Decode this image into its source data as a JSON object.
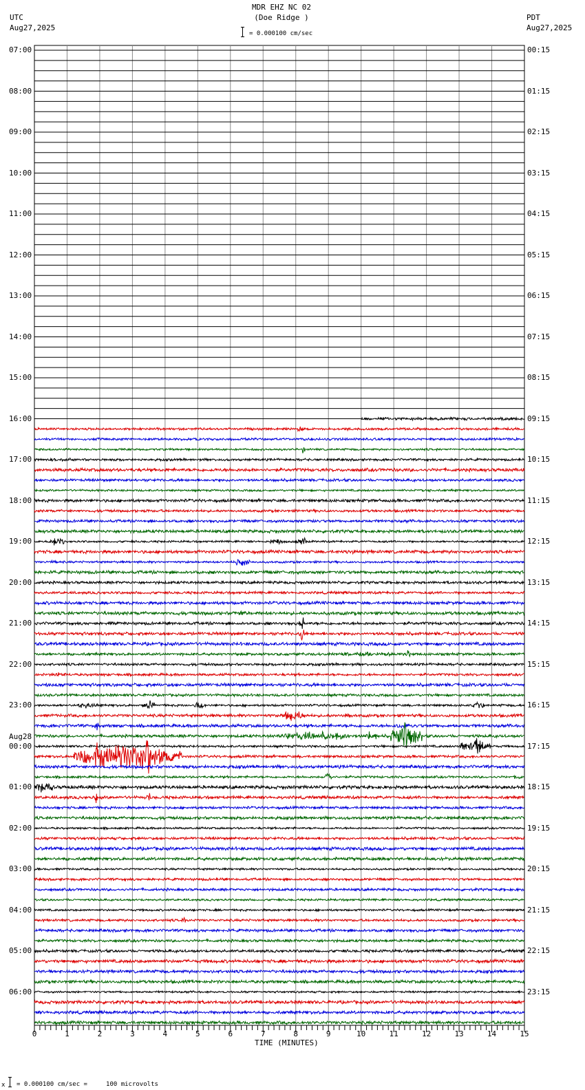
{
  "header": {
    "title": "MDR EHZ NC 02",
    "subtitle": "(Doe Ridge )",
    "left_tz": "UTC",
    "left_date": "Aug27,2025",
    "right_tz": "PDT",
    "right_date": "Aug27,2025",
    "scale_text": "= 0.000100 cm/sec"
  },
  "footer": {
    "prefix": "x",
    "scale_text": "= 0.000100 cm/sec =     100 microvolts"
  },
  "chart_data": {
    "type": "line",
    "title": "MDR EHZ NC 02 (Doe Ridge )",
    "xlabel": "TIME (MINUTES)",
    "xlim": [
      0,
      15
    ],
    "x_ticks": [
      "0",
      "1",
      "2",
      "3",
      "4",
      "5",
      "6",
      "7",
      "8",
      "9",
      "10",
      "11",
      "12",
      "13",
      "14",
      "15"
    ],
    "left_labels": [
      "07:00",
      "08:00",
      "09:00",
      "10:00",
      "11:00",
      "12:00",
      "13:00",
      "14:00",
      "15:00",
      "16:00",
      "17:00",
      "18:00",
      "19:00",
      "20:00",
      "21:00",
      "22:00",
      "23:00",
      "00:00",
      "01:00",
      "02:00",
      "03:00",
      "04:00",
      "05:00",
      "06:00"
    ],
    "date_change_label": "Aug28",
    "right_labels": [
      "00:15",
      "01:15",
      "02:15",
      "03:15",
      "04:15",
      "05:15",
      "06:15",
      "07:15",
      "08:15",
      "09:15",
      "10:15",
      "11:15",
      "12:15",
      "13:15",
      "14:15",
      "15:15",
      "16:15",
      "17:15",
      "18:15",
      "19:15",
      "20:15",
      "21:15",
      "22:15",
      "23:15"
    ],
    "traces_per_hour": 4,
    "trace_count": 96,
    "data_start": {
      "trace": 36,
      "minute": 10
    },
    "trace_colors": [
      "#000000",
      "#dd0000",
      "#0000dd",
      "#006600"
    ],
    "events": [
      {
        "trace": 37,
        "start": 7.9,
        "end": 8.4,
        "amp": 4
      },
      {
        "trace": 37,
        "start": 9.4,
        "end": 9.7,
        "amp": 3
      },
      {
        "trace": 39,
        "start": 8.2,
        "end": 8.28,
        "amp": 13
      },
      {
        "trace": 40,
        "start": 0.3,
        "end": 1.5,
        "amp": 3
      },
      {
        "trace": 43,
        "start": 11.6,
        "end": 12.2,
        "amp": 4
      },
      {
        "trace": 45,
        "start": 3.3,
        "end": 3.6,
        "amp": 3
      },
      {
        "trace": 46,
        "start": 8.4,
        "end": 8.6,
        "amp": 4
      },
      {
        "trace": 48,
        "start": 0.4,
        "end": 0.9,
        "amp": 7
      },
      {
        "trace": 48,
        "start": 7.2,
        "end": 7.6,
        "amp": 6
      },
      {
        "trace": 48,
        "start": 8.0,
        "end": 8.4,
        "amp": 7
      },
      {
        "trace": 49,
        "start": 9.5,
        "end": 9.9,
        "amp": 4
      },
      {
        "trace": 50,
        "start": 0.5,
        "end": 0.7,
        "amp": 4
      },
      {
        "trace": 50,
        "start": 4.7,
        "end": 4.9,
        "amp": 3
      },
      {
        "trace": 50,
        "start": 6.1,
        "end": 6.6,
        "amp": 7
      },
      {
        "trace": 55,
        "start": 6.1,
        "end": 6.5,
        "amp": 5
      },
      {
        "trace": 56,
        "start": 8.1,
        "end": 8.3,
        "amp": 11
      },
      {
        "trace": 56,
        "start": 2.2,
        "end": 2.5,
        "amp": 3
      },
      {
        "trace": 57,
        "start": 8.1,
        "end": 8.25,
        "amp": 12
      },
      {
        "trace": 59,
        "start": 9.0,
        "end": 11.4,
        "amp": 4
      },
      {
        "trace": 59,
        "start": 11.4,
        "end": 11.5,
        "amp": 12
      },
      {
        "trace": 61,
        "start": 0.5,
        "end": 1.0,
        "amp": 4
      },
      {
        "trace": 62,
        "start": 0.3,
        "end": 0.8,
        "amp": 3
      },
      {
        "trace": 64,
        "start": 1.3,
        "end": 1.9,
        "amp": 6
      },
      {
        "trace": 64,
        "start": 3.3,
        "end": 3.7,
        "amp": 9
      },
      {
        "trace": 64,
        "start": 4.9,
        "end": 5.2,
        "amp": 9
      },
      {
        "trace": 64,
        "start": 13.4,
        "end": 13.8,
        "amp": 6
      },
      {
        "trace": 65,
        "start": 7.5,
        "end": 8.3,
        "amp": 10
      },
      {
        "trace": 65,
        "start": 9.4,
        "end": 9.7,
        "amp": 5
      },
      {
        "trace": 66,
        "start": 1.85,
        "end": 1.95,
        "amp": 16
      },
      {
        "trace": 66,
        "start": 11.0,
        "end": 11.6,
        "amp": 6
      },
      {
        "trace": 67,
        "start": 7.4,
        "end": 9.8,
        "amp": 8
      },
      {
        "trace": 67,
        "start": 10.1,
        "end": 10.5,
        "amp": 10
      },
      {
        "trace": 67,
        "start": 10.9,
        "end": 11.9,
        "amp": 18
      },
      {
        "trace": 67,
        "start": 11.25,
        "end": 11.4,
        "amp": 32
      },
      {
        "trace": 68,
        "start": 13.0,
        "end": 14.0,
        "amp": 12
      },
      {
        "trace": 68,
        "start": 13.5,
        "end": 13.65,
        "amp": 20
      },
      {
        "trace": 69,
        "start": 1.2,
        "end": 4.5,
        "amp": 22
      },
      {
        "trace": 69,
        "start": 1.85,
        "end": 1.95,
        "amp": 45
      },
      {
        "trace": 69,
        "start": 3.4,
        "end": 3.55,
        "amp": 40
      },
      {
        "trace": 71,
        "start": 8.9,
        "end": 9.1,
        "amp": 10
      },
      {
        "trace": 71,
        "start": 14.7,
        "end": 14.9,
        "amp": 6
      },
      {
        "trace": 72,
        "start": 0.0,
        "end": 0.6,
        "amp": 9
      },
      {
        "trace": 73,
        "start": 1.85,
        "end": 1.95,
        "amp": 12
      },
      {
        "trace": 73,
        "start": 3.45,
        "end": 3.55,
        "amp": 12
      },
      {
        "trace": 85,
        "start": 4.5,
        "end": 4.7,
        "amp": 6
      },
      {
        "trace": 95,
        "start": 7.1,
        "end": 7.3,
        "amp": 4
      }
    ]
  }
}
